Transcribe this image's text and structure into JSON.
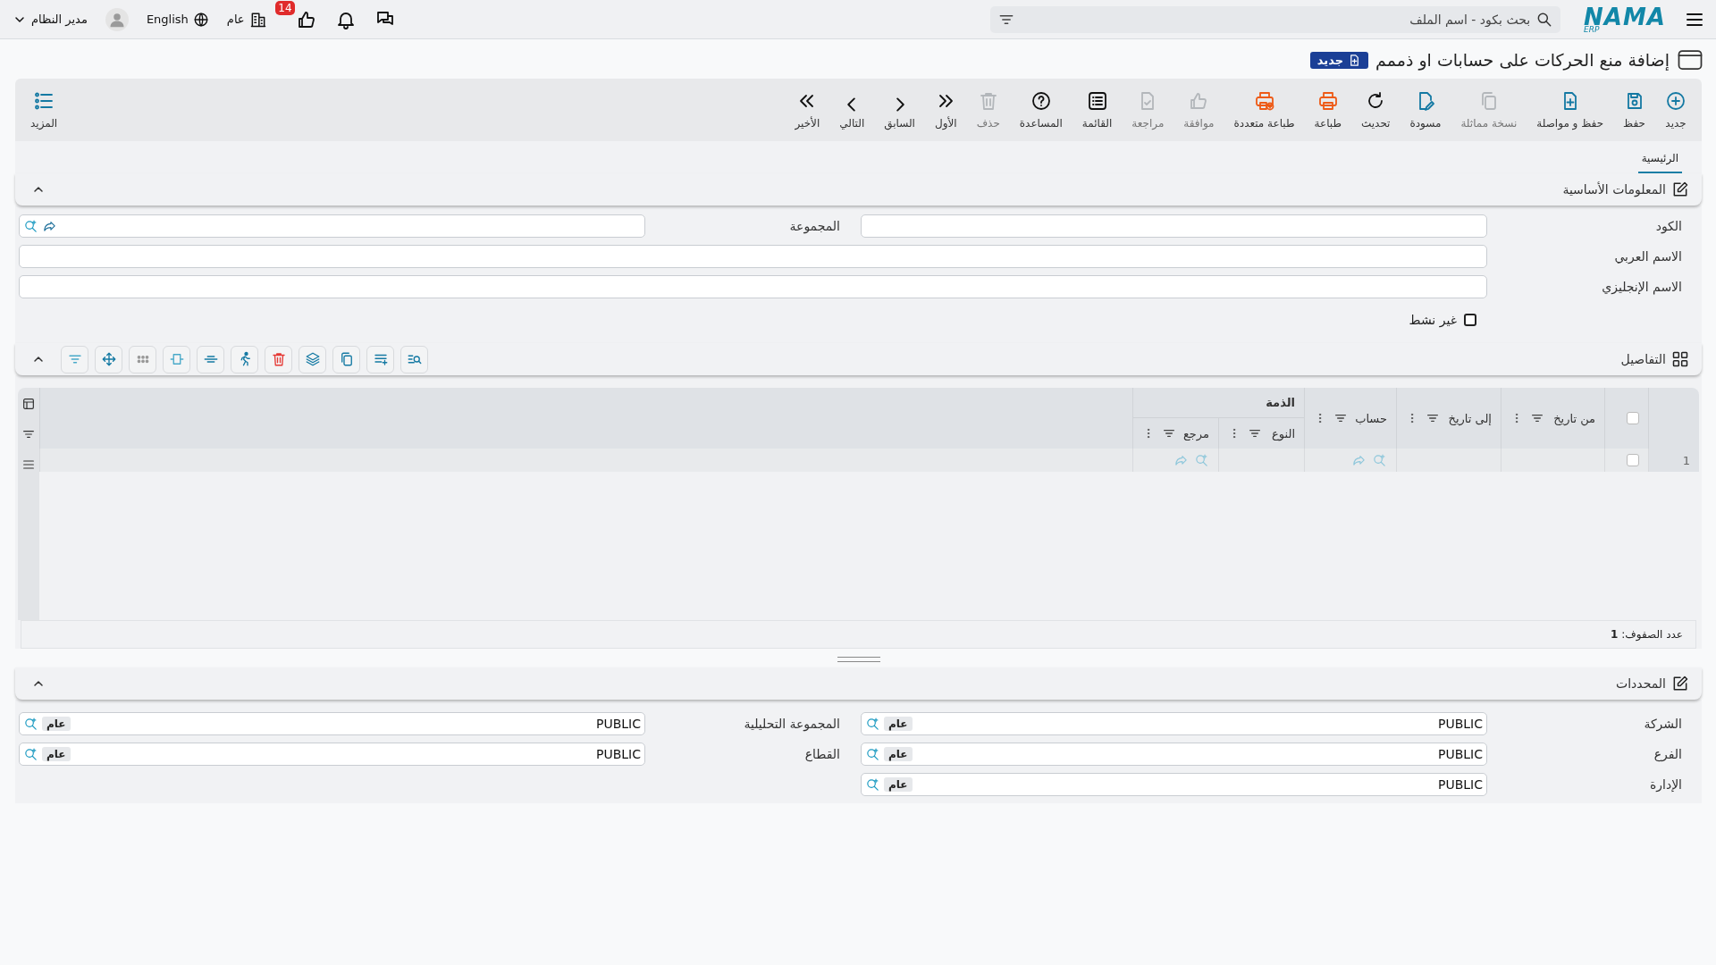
{
  "topbar": {
    "logo": "NAMA",
    "logo_sub": "ERP",
    "search": {
      "placeholder": "بحث بكود - اسم الملف"
    },
    "likes_badge": "14",
    "branch": "عام",
    "language": "English",
    "user": "مدير النظام"
  },
  "page": {
    "title": "إضافة منع الحركات على حسابات او ذممم",
    "status": "جديد"
  },
  "toolbar": {
    "buttons": [
      {
        "label": "جديد",
        "kind": "new",
        "disabled": false
      },
      {
        "label": "حفظ",
        "kind": "save",
        "disabled": false
      },
      {
        "label": "حفظ و مواصلة",
        "kind": "save-continue",
        "disabled": false
      },
      {
        "label": "نسخة مماثلة",
        "kind": "copy",
        "disabled": true
      },
      {
        "label": "مسودة",
        "kind": "draft",
        "disabled": false
      },
      {
        "label": "تحديث",
        "kind": "refresh",
        "disabled": false
      },
      {
        "label": "طباعة",
        "kind": "print",
        "disabled": false
      },
      {
        "label": "طباعة متعددة",
        "kind": "print-multi",
        "disabled": false
      },
      {
        "label": "موافقة",
        "kind": "approve",
        "disabled": true
      },
      {
        "label": "مراجعة",
        "kind": "review",
        "disabled": true
      },
      {
        "label": "القائمة",
        "kind": "list",
        "disabled": false
      },
      {
        "label": "المساعدة",
        "kind": "help",
        "disabled": false
      },
      {
        "label": "حذف",
        "kind": "delete",
        "disabled": true
      },
      {
        "label": "الأول",
        "kind": "first",
        "disabled": false
      },
      {
        "label": "السابق",
        "kind": "prev",
        "disabled": false
      },
      {
        "label": "التالي",
        "kind": "next",
        "disabled": false
      },
      {
        "label": "الأخير",
        "kind": "last",
        "disabled": false
      }
    ],
    "more": "المزيد"
  },
  "tabs": [
    {
      "label": "الرئيسية",
      "selected": true
    }
  ],
  "basic_info": {
    "title": "المعلومات الأساسية",
    "expanded": true,
    "rows": [
      [
        {
          "label": "الكود",
          "kind": "text"
        },
        {
          "label": "المجموعة",
          "kind": "lookup"
        }
      ],
      [
        {
          "label": "الاسم العربي",
          "kind": "text"
        }
      ],
      [
        {
          "label": "الاسم الإنجليزي",
          "kind": "text"
        }
      ]
    ],
    "inactive": {
      "label": "غير نشط",
      "checked": false
    }
  },
  "details": {
    "title": "التفاصيل",
    "expanded": true,
    "grid": {
      "columns": [
        {
          "label": "من تاريخ",
          "kind": "text"
        },
        {
          "label": "إلى تاريخ",
          "kind": "text"
        },
        {
          "label": "حساب",
          "kind": "lookup"
        }
      ],
      "group": {
        "label": "الذمة",
        "columns": [
          {
            "label": "النوع",
            "kind": "text"
          },
          {
            "label": "مرجع",
            "kind": "lookup"
          }
        ]
      },
      "all_selected": false,
      "rows": [
        {
          "number": "1",
          "selected": false
        }
      ],
      "footer": "عدد الصفوف: **1**"
    }
  },
  "determinants": {
    "title": "المحددات",
    "expanded": true,
    "fields": [
      {
        "label": "الشركة",
        "value": "PUBLIC",
        "tag": "عام"
      },
      {
        "label": "المجموعة التحليلية",
        "value": "PUBLIC",
        "tag": "عام"
      },
      {
        "label": "الفرع",
        "value": "PUBLIC",
        "tag": "عام"
      },
      {
        "label": "القطاع",
        "value": "PUBLIC",
        "tag": "عام"
      },
      {
        "label": "الإدارة",
        "value": "PUBLIC",
        "tag": "عام"
      }
    ]
  }
}
